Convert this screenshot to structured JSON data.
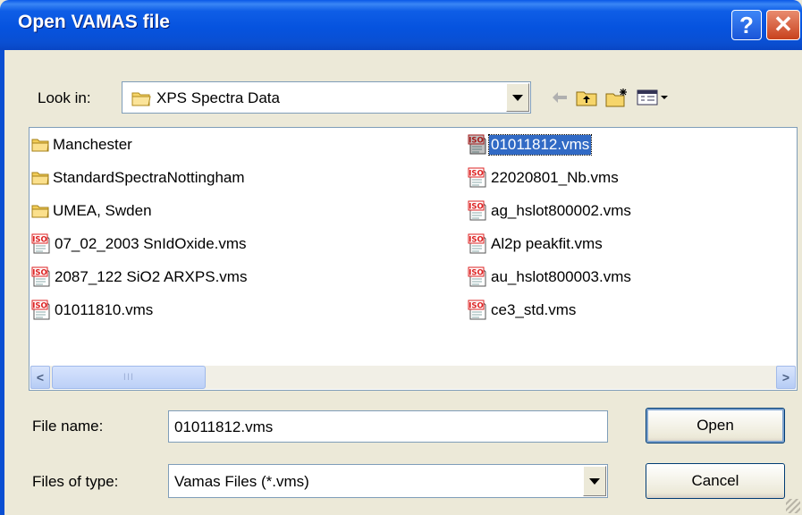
{
  "window": {
    "title": "Open VAMAS file",
    "help_label": "?",
    "close_label": "✕"
  },
  "look_in": {
    "label": "Look in:",
    "value": "XPS Spectra Data"
  },
  "toolbar": {
    "icons": [
      "back-arrow-icon",
      "up-folder-icon",
      "new-folder-icon",
      "view-menu-icon"
    ]
  },
  "files": {
    "left": [
      {
        "name": "Manchester",
        "type": "folder"
      },
      {
        "name": "StandardSpectraNottingham",
        "type": "folder"
      },
      {
        "name": "UMEA, Swden",
        "type": "folder"
      },
      {
        "name": "07_02_2003 SnIdOxide.vms",
        "type": "vms"
      },
      {
        "name": "2087_122 SiO2 ARXPS.vms",
        "type": "vms"
      },
      {
        "name": "01011810.vms",
        "type": "vms"
      }
    ],
    "right": [
      {
        "name": "01011812.vms",
        "type": "vms",
        "selected": true
      },
      {
        "name": "22020801_Nb.vms",
        "type": "vms"
      },
      {
        "name": "ag_hslot800002.vms",
        "type": "vms"
      },
      {
        "name": "Al2p peakfit.vms",
        "type": "vms"
      },
      {
        "name": "au_hslot800003.vms",
        "type": "vms"
      },
      {
        "name": "ce3_std.vms",
        "type": "vms"
      }
    ],
    "iso_text": "ISO"
  },
  "scrollbar": {
    "left": "<",
    "right": ">",
    "grip": "III"
  },
  "file_name": {
    "label": "File name:",
    "value": "01011812.vms"
  },
  "file_type": {
    "label": "Files of type:",
    "value": "Vamas Files (*.vms)"
  },
  "buttons": {
    "open": "Open",
    "cancel": "Cancel"
  }
}
